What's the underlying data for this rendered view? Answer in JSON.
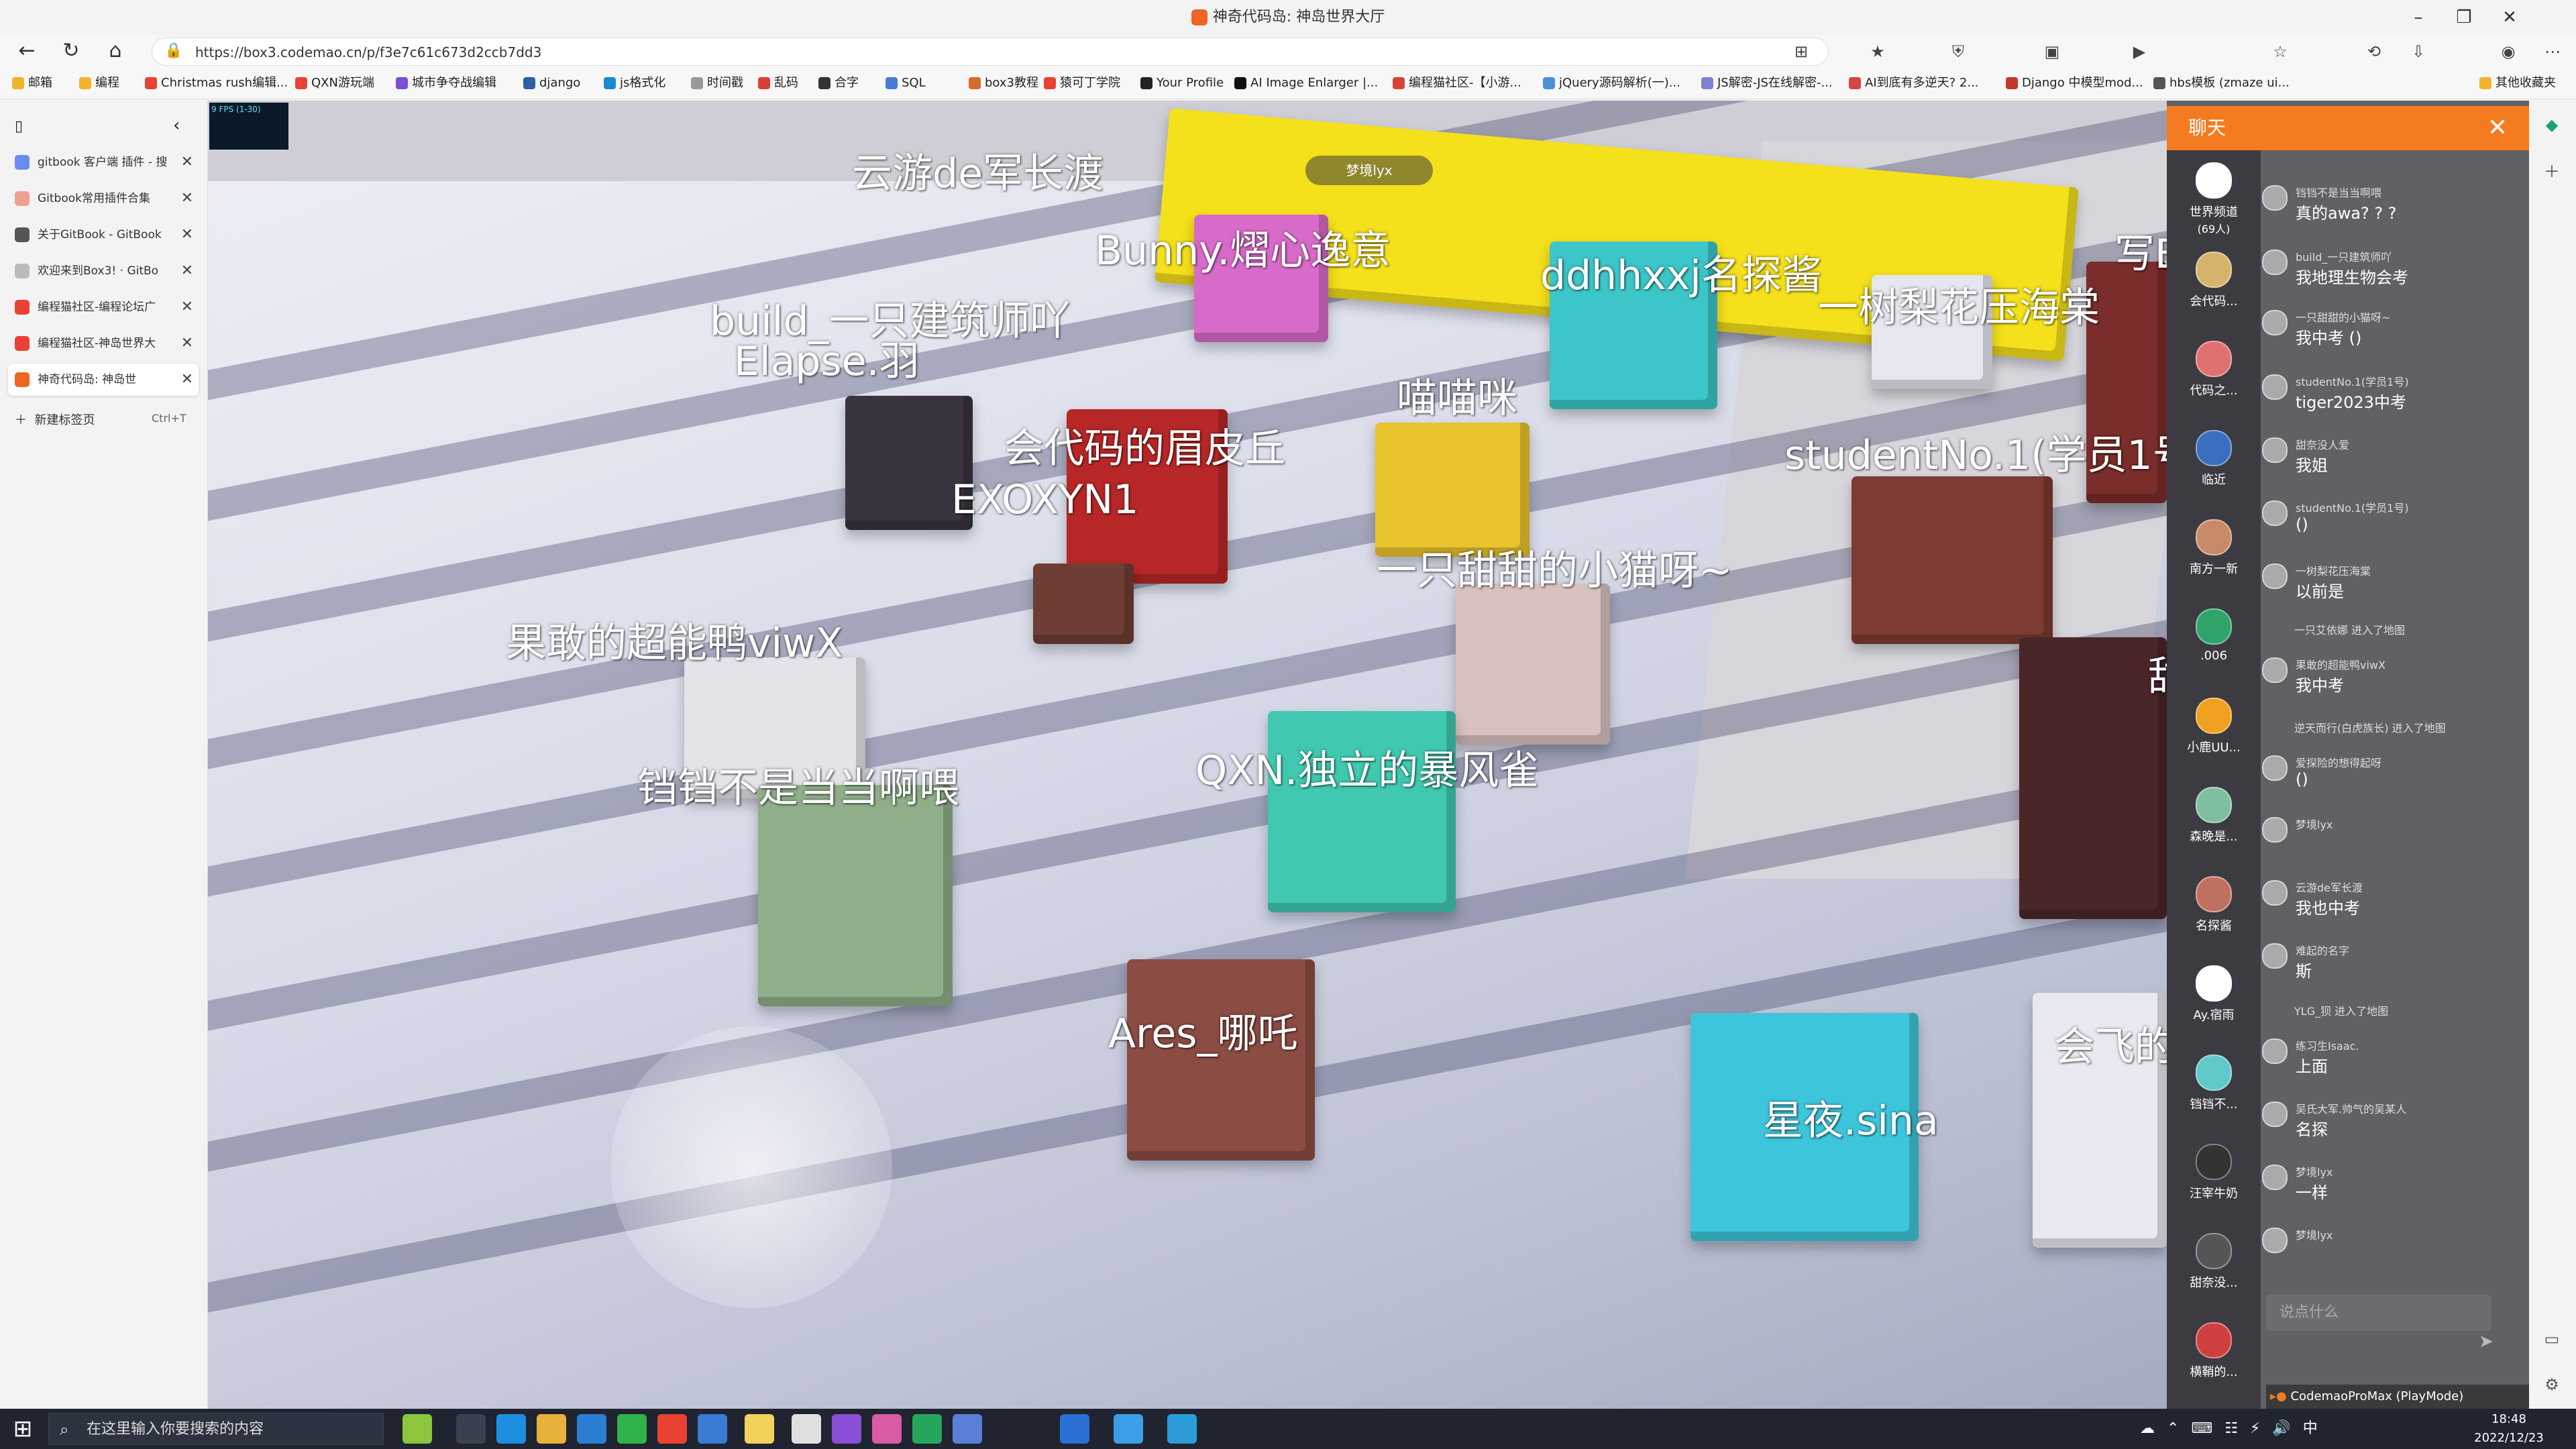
{
  "browser": {
    "title": "神奇代码岛: 神岛世界大厅",
    "url": "https://box3.codemao.cn/p/f3e7c61c673d2ccb7dd3",
    "bookmarks": [
      "邮箱",
      "编程",
      "Christmas rush编辑...",
      "QXN游玩端",
      "城市争夺战编辑",
      "django",
      "js格式化",
      "时间戳",
      "乱码",
      "合字",
      "SQL",
      "box3教程",
      "猿可丁学院",
      "Your Profile",
      "AI Image Enlarger |...",
      "编程猫社区-【小游...",
      "jQuery源码解析(一)...",
      "JS解密-JS在线解密-...",
      "AI到底有多逆天? 2...",
      "Django 中模型mod...",
      "hbs模板 (zmaze ui...",
      "其他收藏夹"
    ],
    "tabs": [
      {
        "label": "gitbook 客户端 插件 - 搜"
      },
      {
        "label": "Gitbook常用插件合集"
      },
      {
        "label": "关于GitBook - GitBook"
      },
      {
        "label": "欢迎来到Box3! · GitBo"
      },
      {
        "label": "编程猫社区-编程论坛广"
      },
      {
        "label": "编程猫社区-神岛世界大"
      },
      {
        "label": "神奇代码岛: 神岛世"
      }
    ],
    "new_tab": {
      "label": "新建标签页",
      "shortcut": "Ctrl+T"
    }
  },
  "game": {
    "fps": "9 FPS (1-30)",
    "center_tag": "梦境lyx",
    "players": [
      "云游de军长渡",
      "Bunny.熠心逸意",
      "ddhhxxj名探酱",
      "一树梨花压海棠",
      "build_一只建筑师吖",
      "Elapse.羽",
      "喵喵咪",
      "会代码的眉皮丘",
      "studentNo.1(学员1号)",
      "EXOXYN1",
      "一只甜甜的小猫呀~",
      "果敢的超能鸭viwX",
      "QXN.独立的暴风雀",
      "铛铛不是当当啊喂",
      "Ares_哪吒",
      "星夜.sina",
      "会飞的",
      "写BUG的魔术师 Yif",
      "甜心没人爱"
    ]
  },
  "chat": {
    "title": "聊天",
    "channels": [
      {
        "name": "世界频道",
        "count": "(69人)"
      },
      {
        "name": "会代码..."
      },
      {
        "name": "代码之..."
      },
      {
        "name": "临近"
      },
      {
        "name": "南方一新"
      },
      {
        "name": ".006"
      },
      {
        "name": "小鹿UU..."
      },
      {
        "name": "森晚是..."
      },
      {
        "name": "名探酱"
      },
      {
        "name": "Ay.宿雨"
      },
      {
        "name": "铛铛不..."
      },
      {
        "name": "汪宰牛奶"
      },
      {
        "name": "甜奈没..."
      },
      {
        "name": "横鞘的..."
      }
    ],
    "messages": [
      {
        "who": "铛铛不是当当啊喂",
        "text": "真的awa? ? ?"
      },
      {
        "who": "build_一只建筑师吖",
        "text": "我地理生物会考"
      },
      {
        "who": "一只甜甜的小猫呀~",
        "text": "我中考 ()"
      },
      {
        "who": "studentNo.1(学员1号)",
        "text": "tiger2023中考"
      },
      {
        "who": "甜奈没人爱",
        "text": "我姐"
      },
      {
        "who": "studentNo.1(学员1号)",
        "text": "()"
      },
      {
        "who": "一树梨花压海棠",
        "text": "以前是"
      },
      {
        "system": "一只艾依娜 进入了地图"
      },
      {
        "who": "果敢的超能鸭viwX",
        "text": "我中考"
      },
      {
        "system": "逆天而行(白虎族长) 进入了地图"
      },
      {
        "who": "爱探险的想得起呀",
        "text": "()"
      },
      {
        "who": "梦境lyx",
        "text": ""
      },
      {
        "who": "云游de军长渡",
        "text": "我也中考"
      },
      {
        "who": "难起的名字",
        "text": "斯"
      },
      {
        "system": "YLG_狈 进入了地图"
      },
      {
        "who": "练习生Isaac.",
        "text": "上面"
      },
      {
        "who": "吴氏大军.帅气的吴某人",
        "text": "名探"
      },
      {
        "who": "梦境lyx",
        "text": "一样"
      },
      {
        "who": "梦境lyx",
        "text": ""
      }
    ],
    "input_placeholder": "说点什么",
    "footer": "CodemaoProMax (PlayMode)"
  },
  "taskbar": {
    "search_placeholder": "在这里输入你要搜索的内容",
    "time": "18:48",
    "date": "2022/12/23"
  },
  "colors": {
    "chat_header": "#f47b20",
    "taskbar": "#1f2430"
  }
}
